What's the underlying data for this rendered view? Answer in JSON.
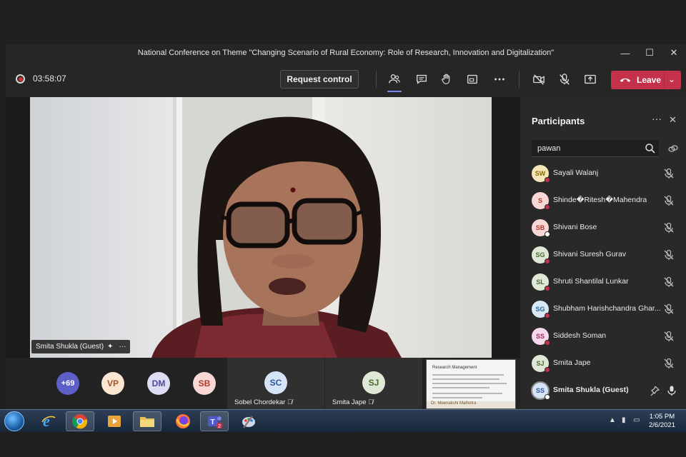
{
  "window": {
    "title": "National Conference on Theme \"Changing Scenario of Rural Economy: Role of Research, Innovation and Digitalization\"",
    "controls": [
      "—",
      "☐",
      "✕"
    ]
  },
  "toolbar": {
    "timer": "03:58:07",
    "request_control_label": "Request control",
    "leave_label": "Leave",
    "icons": [
      "participants-icon",
      "chat-icon",
      "raise-hand-icon",
      "share-tray-icon",
      "more-actions-icon",
      "camera-off-icon",
      "mic-off-icon",
      "share-screen-icon"
    ]
  },
  "stage": {
    "speaker_name": "Smita Shukla (Guest)",
    "more": "···"
  },
  "strip": {
    "overflow_count": "+69",
    "avatars": [
      {
        "initials": "VP",
        "bg": "#fce6d2",
        "fg": "#a0522d"
      },
      {
        "initials": "DM",
        "bg": "#dcdcf2",
        "fg": "#4a4a9a"
      },
      {
        "initials": "SB",
        "bg": "#f8d7d4",
        "fg": "#b03a2e"
      }
    ],
    "tiles": [
      {
        "initials": "SC",
        "name": "Sobel Chordekar",
        "bg": "#d6e4f5",
        "fg": "#2b579a"
      },
      {
        "initials": "SJ",
        "name": "Smita Jape",
        "bg": "#dfe8d6",
        "fg": "#4b6b2b"
      }
    ],
    "share_preview": {
      "heading": "Research Management",
      "footer": "Dr. Meenakshi Malhotra"
    }
  },
  "participants": {
    "title": "Participants",
    "more": "···",
    "close": "✕",
    "search_value": "pawan",
    "list": [
      {
        "initials": "SW",
        "name": "Sayali Walanj",
        "bg": "#f5e6b8",
        "fg": "#8a6a00",
        "status": "#c4314b"
      },
      {
        "initials": "S",
        "name": "Shinde�Ritesh�Mahendra",
        "bg": "#f8d7d4",
        "fg": "#b03a2e",
        "status": "#c4314b"
      },
      {
        "initials": "SB",
        "name": "Shivani Bose",
        "bg": "#f8d7d4",
        "fg": "#b03a2e",
        "status": "#ffffff"
      },
      {
        "initials": "SG",
        "name": "Shivani Suresh Gurav",
        "bg": "#dfe8d6",
        "fg": "#4b6b2b",
        "status": "#c4314b"
      },
      {
        "initials": "SL",
        "name": "Shruti Shantilal Lunkar",
        "bg": "#dfe8d6",
        "fg": "#4b6b2b",
        "status": "#c4314b"
      },
      {
        "initials": "SG",
        "name": "Shubham Harishchandra Ghar...",
        "bg": "#d6e9f5",
        "fg": "#2b6a9a",
        "status": "#c4314b"
      },
      {
        "initials": "SS",
        "name": "Siddesh Soman",
        "bg": "#f6d9ea",
        "fg": "#9a2b6a",
        "status": "#c4314b"
      },
      {
        "initials": "SJ",
        "name": "Smita Jape",
        "bg": "#dfe8d6",
        "fg": "#4b6b2b",
        "status": "#c4314b"
      },
      {
        "initials": "SS",
        "name": "Smita Shukla (Guest)",
        "bg": "#d6e4f5",
        "fg": "#2b579a",
        "status": "#ffffff"
      }
    ]
  },
  "taskbar": {
    "time": "1:05 PM",
    "date": "2/6/2021",
    "teams_badge": "2",
    "apps": [
      "windows-media-center-icon",
      "internet-explorer-icon",
      "chrome-icon",
      "media-player-icon",
      "file-explorer-icon",
      "firefox-icon",
      "teams-icon",
      "paint-icon"
    ]
  }
}
